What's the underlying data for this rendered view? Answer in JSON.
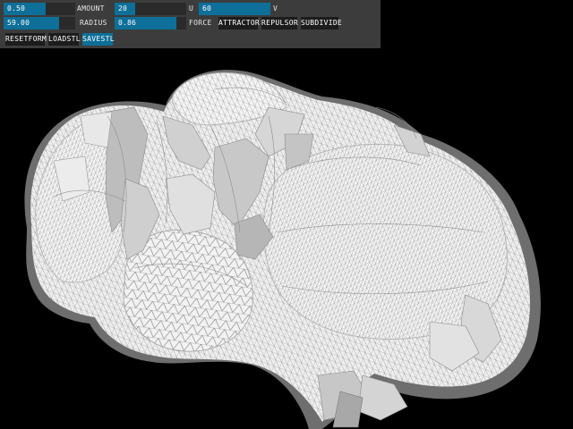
{
  "gui": {
    "accent_color": "#0e6f98",
    "panel_color": "#3c3c3c",
    "sliders": {
      "amount": {
        "value": "0.50",
        "label": "AMOUNT",
        "level": 0.59
      },
      "u": {
        "value": "20",
        "label": "U",
        "level": 0.29
      },
      "v": {
        "value": "60",
        "label": "V",
        "level": 1.0
      },
      "radius": {
        "value": "59.00",
        "label": "RADIUS",
        "level": 0.78
      },
      "force": {
        "value": "0.86",
        "label": "FORCE",
        "level": 0.86
      }
    },
    "buttons": {
      "attractor": "ATTRACTOR",
      "repulsor": "REPULSOR",
      "subdivide": "SUBDIVIDE",
      "resetform": "RESETFORM",
      "loadstl": "LOADSTL",
      "savestl": "SAVESTL"
    }
  },
  "viewport": {
    "background": "#000000",
    "mesh_color": "#f0f0f0",
    "wire_color": "#9a9a9a",
    "icon": "wireframe-mesh"
  }
}
